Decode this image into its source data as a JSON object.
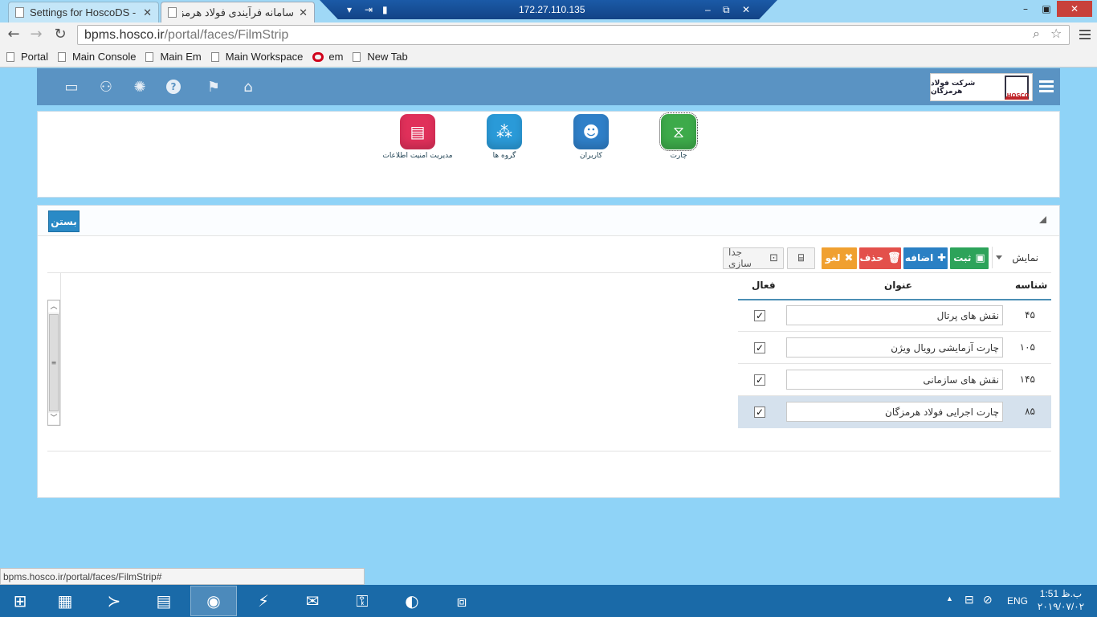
{
  "browser": {
    "tabs": [
      {
        "title": "Settings for HoscoDS - Ro",
        "active": false
      },
      {
        "title": "سامانه فرآیندی فولاد هرمزگان",
        "active": true
      }
    ],
    "remote_ip": "172.27.110.135",
    "url_host": "bpms.hosco.ir",
    "url_path": "/portal/faces/FilmStrip",
    "bookmarks": [
      "Portal",
      "Main Console",
      "Main Em",
      "Main Workspace",
      "em",
      "New Tab"
    ],
    "status_url": "bpms.hosco.ir/portal/faces/FilmStrip#"
  },
  "header": {
    "company_name": "شرکت فولاد هرمزگان",
    "logo_text": "HOSCO",
    "icons": [
      "keyboard-icon",
      "users-door-icon",
      "settings-icon",
      "help-icon",
      "flag-icon",
      "home-icon"
    ]
  },
  "apps": [
    {
      "label": "چارت",
      "icon": "org-chart-icon",
      "color": "#3daa4a"
    },
    {
      "label": "کاربران",
      "icon": "users-icon",
      "color": "#2f7fc8"
    },
    {
      "label": "گروه ها",
      "icon": "groups-icon",
      "color": "#2a9ad8"
    },
    {
      "label": "مدیریت امنیت اطلاعات",
      "icon": "security-icon",
      "color": "#e0305a"
    }
  ],
  "panel": {
    "close_label": "بستن",
    "show_label": "نمایش",
    "actions": {
      "save": "ثبت",
      "add": "اضافه",
      "delete": "حذف",
      "cancel": "لغو",
      "separate": "جدا سازی"
    },
    "columns": {
      "id": "شناسه",
      "title": "عنوان",
      "active": "فعال"
    },
    "rows": [
      {
        "id": "۴۵",
        "title": "نقش های پرتال",
        "active": true,
        "selected": false
      },
      {
        "id": "۱۰۵",
        "title": "چارت آزمایشی رویال ویژن",
        "active": true,
        "selected": false
      },
      {
        "id": "۱۴۵",
        "title": "نقش های سازمانی",
        "active": true,
        "selected": false
      },
      {
        "id": "۸۵",
        "title": "چارت  اجرایی فولاد هرمزگان",
        "active": true,
        "selected": true
      }
    ]
  },
  "taskbar": {
    "lang": "ENG",
    "time": "ب.ظ 1:51",
    "date": "۲۰۱۹/۰۷/۰۲"
  }
}
